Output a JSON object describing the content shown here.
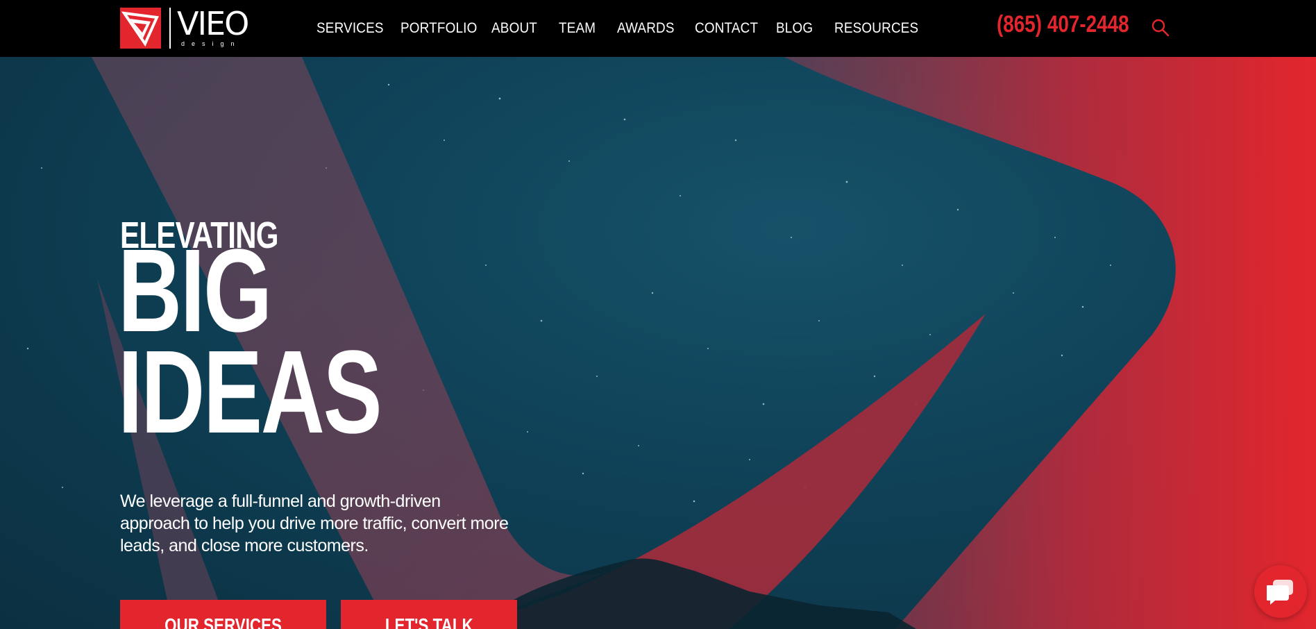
{
  "brand": {
    "logo_word": "VIEO",
    "logo_sub": "design"
  },
  "nav": {
    "items": [
      {
        "label": "SERVICES"
      },
      {
        "label": "PORTFOLIO"
      },
      {
        "label": "ABOUT"
      },
      {
        "label": "TEAM"
      },
      {
        "label": "AWARDS"
      },
      {
        "label": "CONTACT"
      },
      {
        "label": "BLOG"
      },
      {
        "label": "RESOURCES"
      }
    ],
    "phone": "(865) 407-2448",
    "search_icon": "search-icon"
  },
  "hero": {
    "eyebrow": "ELEVATING",
    "headline_line1": "BIG",
    "headline_line2": "IDEAS",
    "lede": "We leverage a full-funnel and growth-driven approach to help you drive more traffic, convert more leads, and close more customers.",
    "buttons": {
      "services": "OUR SERVICES",
      "talk": "LET'S TALK"
    }
  },
  "chat": {
    "icon": "chat-bubble-icon"
  },
  "colors": {
    "accent": "#e3262d",
    "header_bg": "#000000",
    "sky": "#0f4157"
  }
}
